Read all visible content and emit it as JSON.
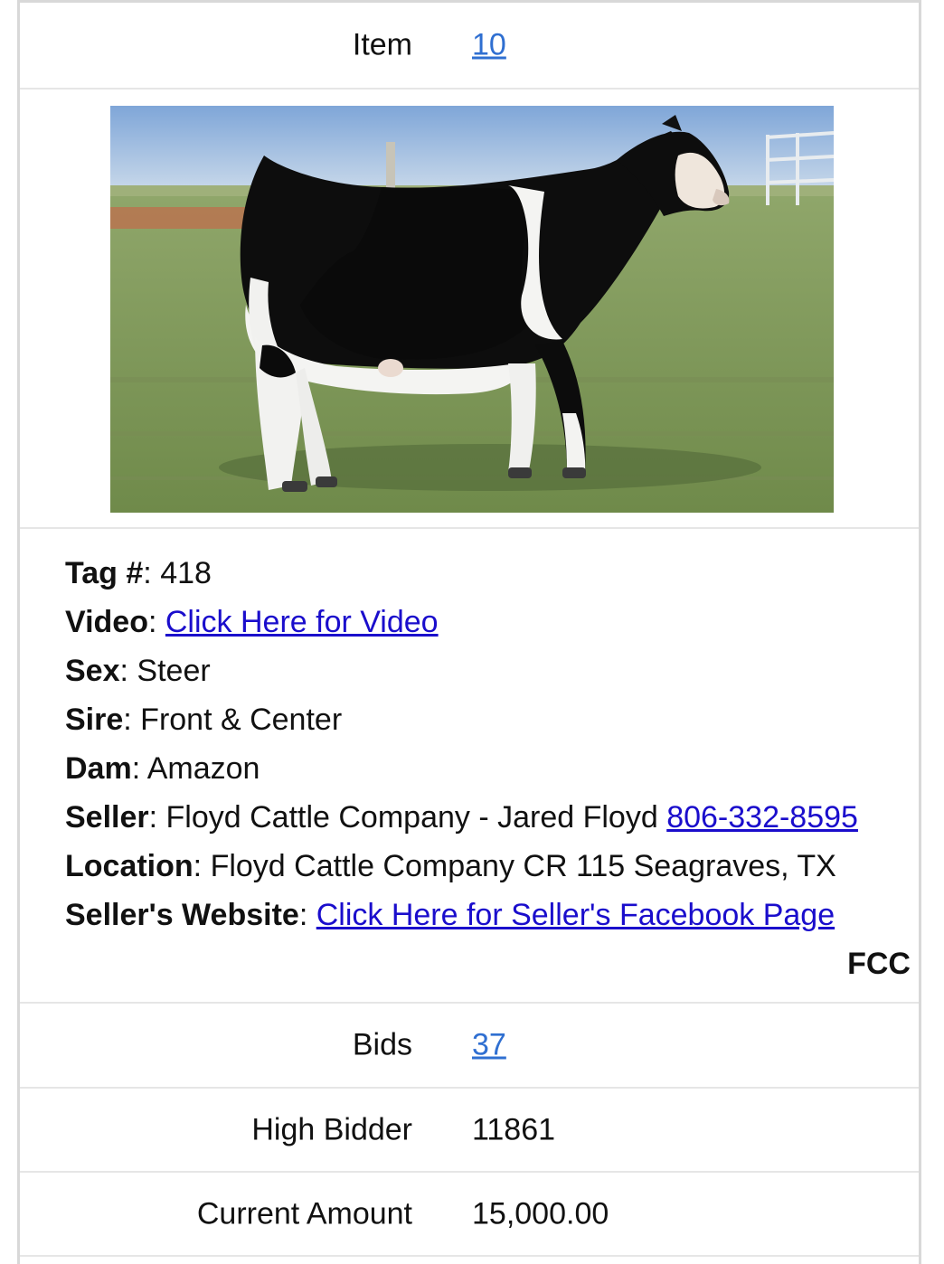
{
  "item": {
    "label": "Item",
    "value": "10"
  },
  "photo": {
    "alt": "Black and white steer standing in a grassy pasture"
  },
  "details": {
    "tag": {
      "label": "Tag #",
      "value": "418"
    },
    "video": {
      "label": "Video",
      "link_text": "Click Here for Video"
    },
    "sex": {
      "label": "Sex",
      "value": "Steer"
    },
    "sire": {
      "label": "Sire",
      "value": "Front & Center"
    },
    "dam": {
      "label": "Dam",
      "value": "Amazon"
    },
    "seller": {
      "label": "Seller",
      "value": "Floyd Cattle Company - Jared Floyd",
      "phone": "806-332-8595"
    },
    "location": {
      "label": "Location",
      "value": "Floyd Cattle Company CR 115 Seagraves, TX"
    },
    "website": {
      "label": "Seller's Website",
      "link_text": "Click Here for Seller's Facebook Page"
    },
    "code": "FCC"
  },
  "bids": {
    "label": "Bids",
    "value": "37"
  },
  "high_bidder": {
    "label": "High Bidder",
    "value": "11861"
  },
  "current_amount": {
    "label": "Current Amount",
    "value": "15,000.00"
  },
  "colors": {
    "link": "#2f6fd1",
    "detail_link": "#1a0dcc",
    "divider": "#e6e6e6"
  }
}
